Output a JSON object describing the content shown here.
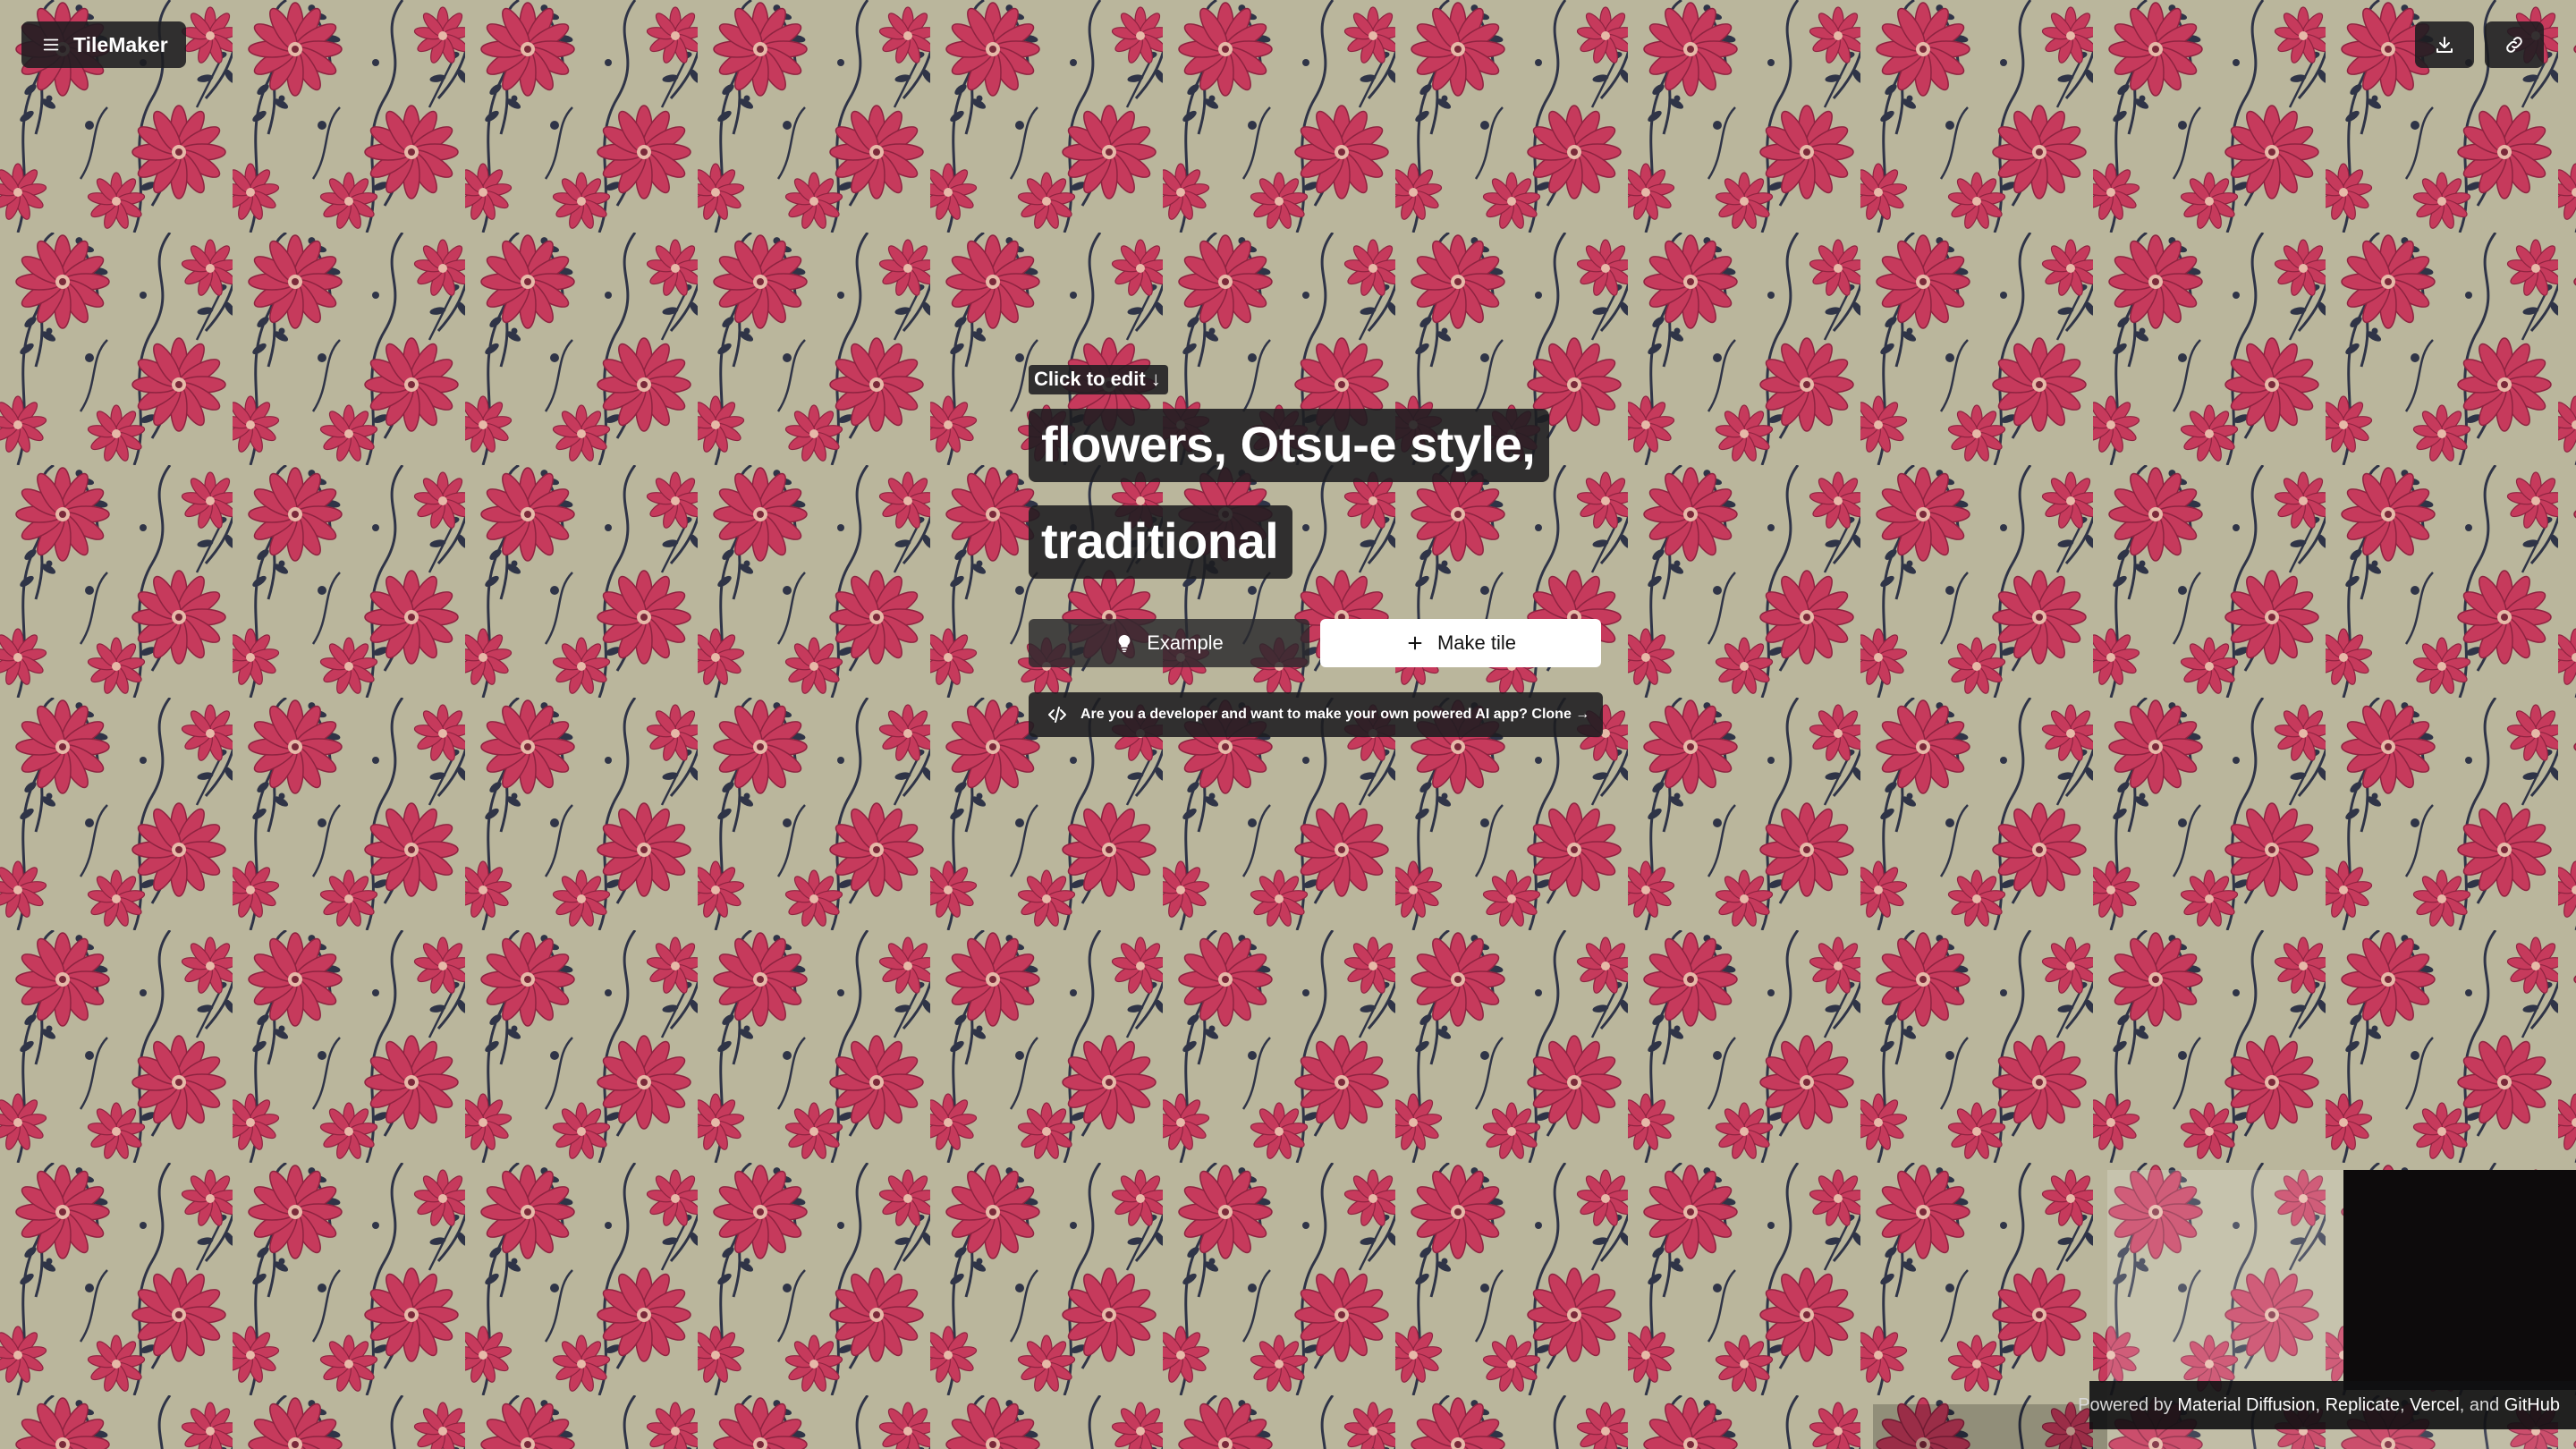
{
  "app": {
    "name": "TileMaker"
  },
  "colors": {
    "background": "#b9b59b",
    "flower": "#c8385a",
    "flower_dark": "#9e2745",
    "leaf": "#2f3447",
    "pill": "#1c1c20",
    "button_light": "#ffffff"
  },
  "header": {
    "menu_icon": "menu-icon",
    "download_icon": "download-icon",
    "link_icon": "link-icon"
  },
  "editor": {
    "hint": "Click to edit ↓",
    "prompt_line_1": "flowers, Otsu-e style,",
    "prompt_line_2": "traditional"
  },
  "actions": {
    "example_label": "Example",
    "example_icon": "lightbulb-icon",
    "make_tile_label": "Make tile",
    "make_tile_icon": "plus-icon"
  },
  "dev_banner": {
    "icon": "code-icon",
    "text": "Are you a developer and want to make your own powered AI app? Clone →"
  },
  "footer": {
    "prefix": "Powered by",
    "links": [
      "Material Diffusion",
      "Replicate",
      "Vercel",
      "GitHub"
    ],
    "sep_1": ",",
    "sep_2": ",",
    "sep_3": ", and"
  }
}
